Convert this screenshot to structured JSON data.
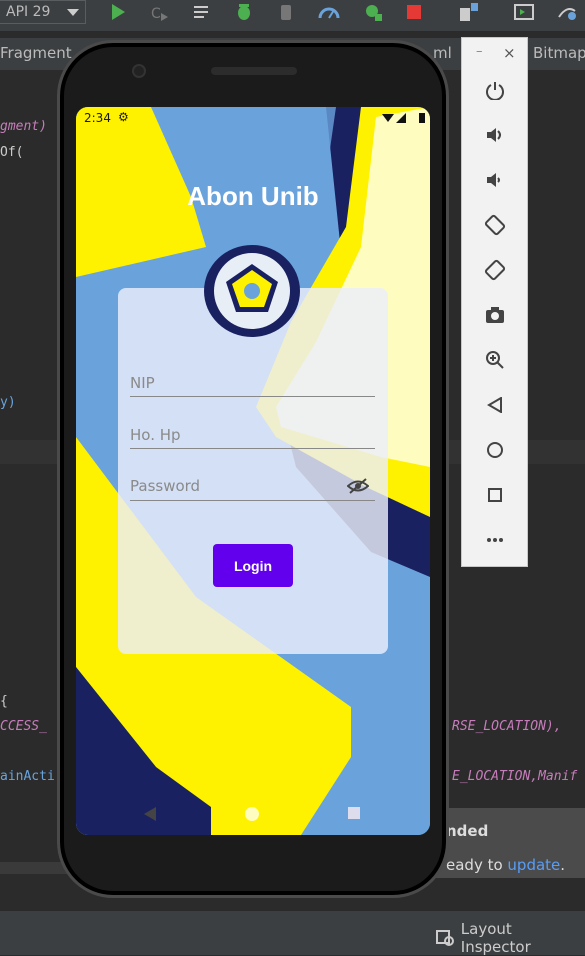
{
  "toolbar": {
    "api_label": "API 29"
  },
  "tabs": {
    "left": "Fragment",
    "mid": "ml",
    "right": "Bitmap"
  },
  "code": {
    "line1": "gment)",
    "line2": "Of(",
    "line3": "y)",
    "line4": "{",
    "line5": "CCESS_",
    "line6": "ainActi",
    "line7": "RSE_LOCATION),",
    "line8": "E_LOCATION,Manif"
  },
  "notice": {
    "title": "nded",
    "body_prefix": "eady to ",
    "link": "update",
    "suffix": "."
  },
  "status": {
    "layout_inspector": "Layout Inspector"
  },
  "phone": {
    "time": "2:34",
    "app_title": "Abon Unib",
    "nip_placeholder": "NIP",
    "hp_placeholder": "Ho. Hp",
    "password_placeholder": "Password",
    "login_label": "Login"
  },
  "colors": {
    "accent": "#6200ee",
    "yellow": "#fff200",
    "navy": "#1a2160",
    "sky": "#6aa3dc"
  },
  "emulator_panel": {
    "close": "×",
    "minimize": "–",
    "buttons": [
      "power-icon",
      "volume-up-icon",
      "volume-down-icon",
      "rotate-left-icon",
      "rotate-right-icon",
      "camera-icon",
      "zoom-icon",
      "back-icon",
      "home-icon",
      "overview-icon",
      "more-icon"
    ]
  }
}
